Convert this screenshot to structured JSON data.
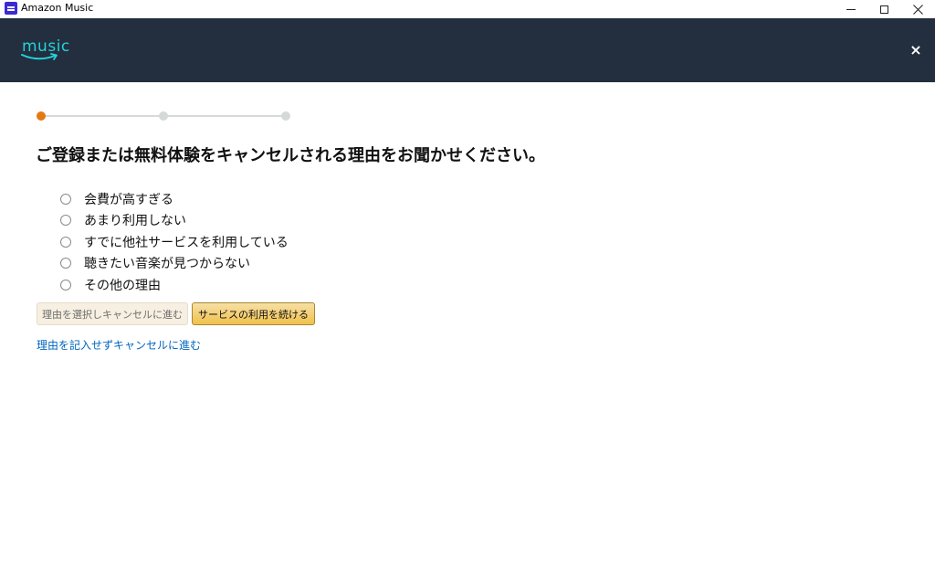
{
  "window": {
    "title": "Amazon Music",
    "controls": {
      "minimize": "minimize-icon",
      "maximize": "maximize-icon",
      "close": "close-icon"
    }
  },
  "header": {
    "logo_text": "music",
    "close_glyph": "×",
    "background_color": "#232f3e",
    "logo_color": "#25d1da"
  },
  "stepper": {
    "current_step": 1,
    "total_steps": 3,
    "active_color": "#e47911",
    "inactive_color": "#d5d9d9"
  },
  "survey": {
    "question": "ご登録または無料体験をキャンセルされる理由をお聞かせください。",
    "options": [
      {
        "label": "会費が高すぎる",
        "selected": false
      },
      {
        "label": "あまり利用しない",
        "selected": false
      },
      {
        "label": "すでに他社サービスを利用している",
        "selected": false
      },
      {
        "label": "聴きたい音楽が見つからない",
        "selected": false
      },
      {
        "label": "その他の理由",
        "selected": false
      }
    ]
  },
  "actions": {
    "cancel_with_reason_label": "理由を選択しキャンセルに進む",
    "continue_label": "サービスの利用を続ける",
    "skip_link_label": "理由を記入せずキャンセルに進む",
    "link_color": "#0066c0",
    "continue_color": "#f0c14b"
  }
}
